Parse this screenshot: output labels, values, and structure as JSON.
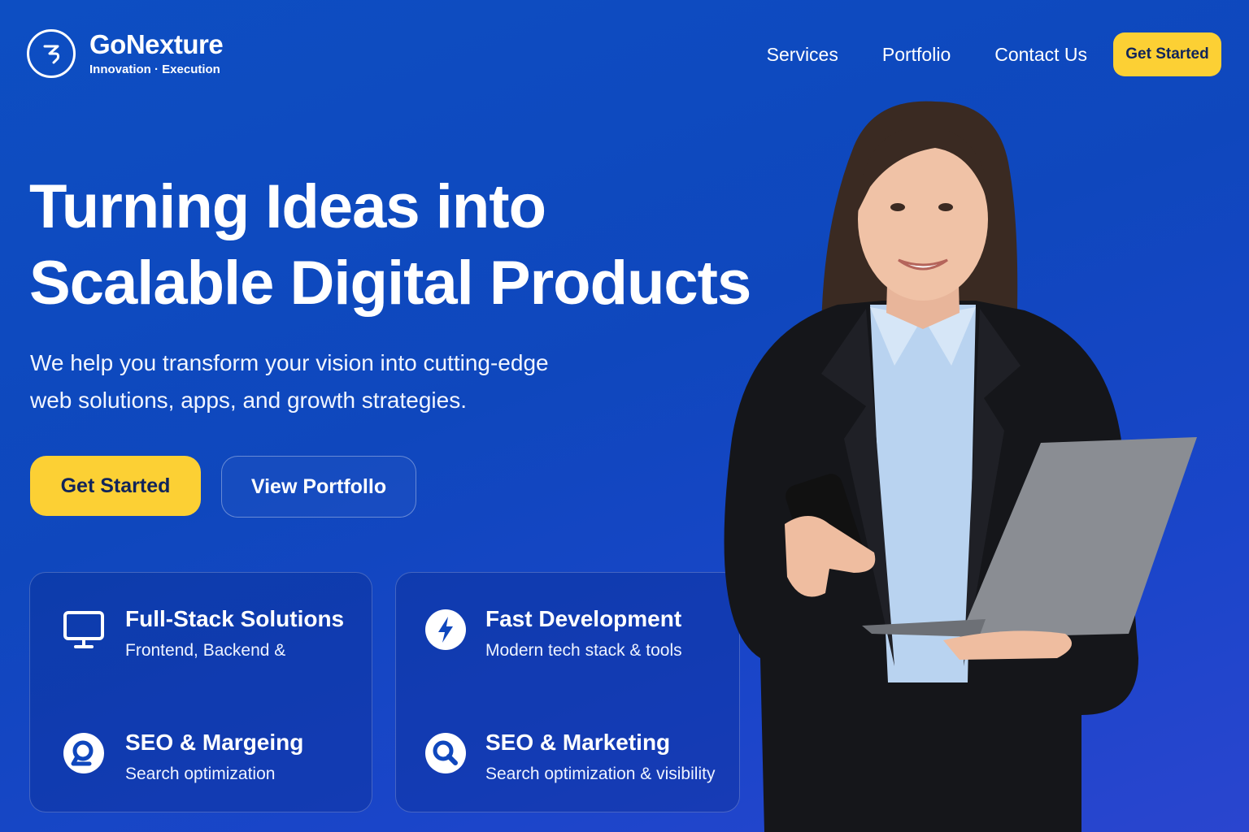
{
  "brand": {
    "name": "GoNexture",
    "tagline": "Innovation · Execution"
  },
  "nav": {
    "links": [
      "Services",
      "Portfolio",
      "Contact Us"
    ],
    "cta_label": "Get Started"
  },
  "hero": {
    "headline_line1": "Turning Ideas into",
    "headline_line2": "Scalable Digital Products",
    "subtext_line1": "We help you transform your vision into cutting-edge",
    "subtext_line2": "web solutions, apps, and growth strategies.",
    "primary_label": "Get Started",
    "secondary_label": "View Portfollo"
  },
  "features": [
    {
      "icon": "monitor-icon",
      "title": "Full-Stack Solutions",
      "desc": "Frontend, Backend &"
    },
    {
      "icon": "search-icon",
      "title": "SEO & Margeing",
      "desc": "Search optimization"
    },
    {
      "icon": "lightning-icon",
      "title": "Fast Development",
      "desc": "Modern tech stack & tools"
    },
    {
      "icon": "search-icon",
      "title": "SEO & Marketing",
      "desc": "Search optimization & visibility"
    }
  ],
  "colors": {
    "background": "#0f47bd",
    "accent": "#fcd034",
    "text": "#ffffff"
  }
}
